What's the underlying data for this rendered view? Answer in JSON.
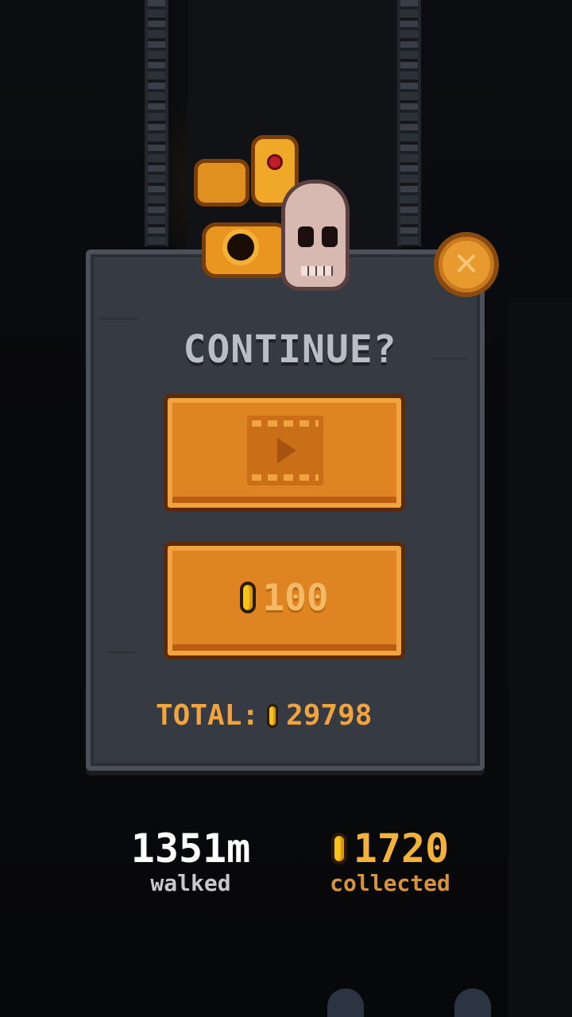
{
  "dialog": {
    "title": "CONTINUE?",
    "close_icon_glyph": "✕",
    "video_button": {
      "icon": "video-ad-icon"
    },
    "coin_button": {
      "icon": "coin-icon",
      "price": "100"
    },
    "total": {
      "label": "TOTAL:",
      "value": "29798"
    }
  },
  "stats": {
    "distance": {
      "value": "1351m",
      "label": "walked"
    },
    "coins": {
      "value": "1720",
      "label": "collected"
    }
  },
  "colors": {
    "accent_orange": "#de8423",
    "coin_gold": "#f7c21e",
    "panel": "#363a42"
  }
}
